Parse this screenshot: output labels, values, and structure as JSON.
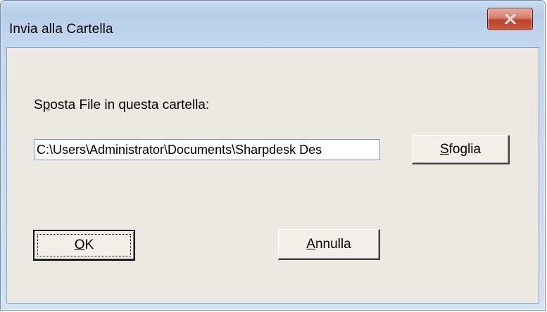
{
  "window": {
    "title": "Invia alla Cartella",
    "close_icon": "close-x-icon"
  },
  "form": {
    "label_before": "S",
    "label_mnemonic": "p",
    "label_after": "osta File in questa cartella:",
    "path_value": "C:\\Users\\Administrator\\Documents\\Sharpdesk Des"
  },
  "buttons": {
    "browse_mnemonic": "S",
    "browse_rest": "foglia",
    "ok_mnemonic": "O",
    "ok_rest": "K",
    "cancel_mnemonic": "A",
    "cancel_rest": "nnulla"
  }
}
